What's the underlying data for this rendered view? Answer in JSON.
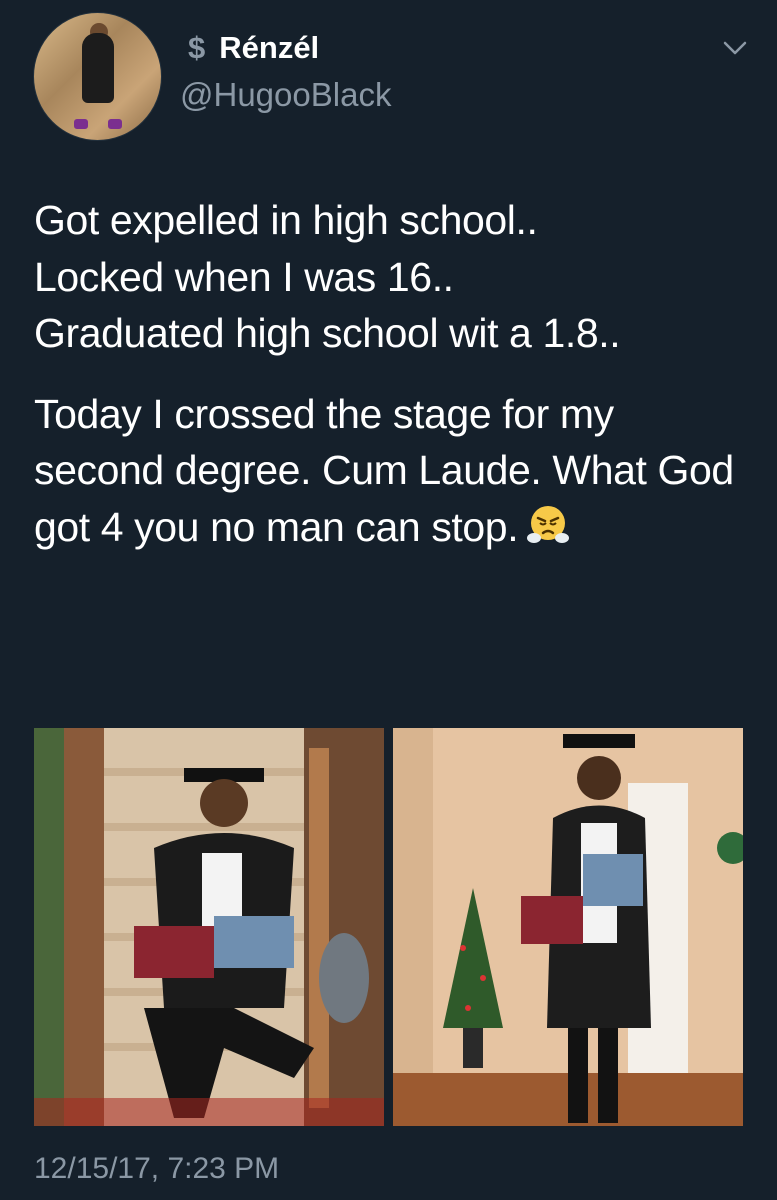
{
  "author": {
    "display_name": "Rénzél",
    "name_prefix_symbol": "$",
    "handle": "@HugooBlack",
    "avatar": "profile-photo"
  },
  "tweet": {
    "lines_paragraph1": [
      "Got expelled in high school..",
      "Locked when I was 16..",
      "Graduated high school wit a 1.8.."
    ],
    "paragraph2": "Today I crossed the stage for my second degree. Cum Laude. What God got 4 you no man can stop.",
    "emoji": "face-with-steam-from-nose"
  },
  "media": [
    {
      "description_icon": "graduation-photo-stairs"
    },
    {
      "description_icon": "graduation-photo-christmas-tree"
    }
  ],
  "timestamp": "12/15/17, 7:23 PM",
  "colors": {
    "background": "#15202b",
    "text": "#ffffff",
    "secondary_text": "#8b98a5"
  },
  "icons": {
    "menu": "chevron-down-icon"
  }
}
